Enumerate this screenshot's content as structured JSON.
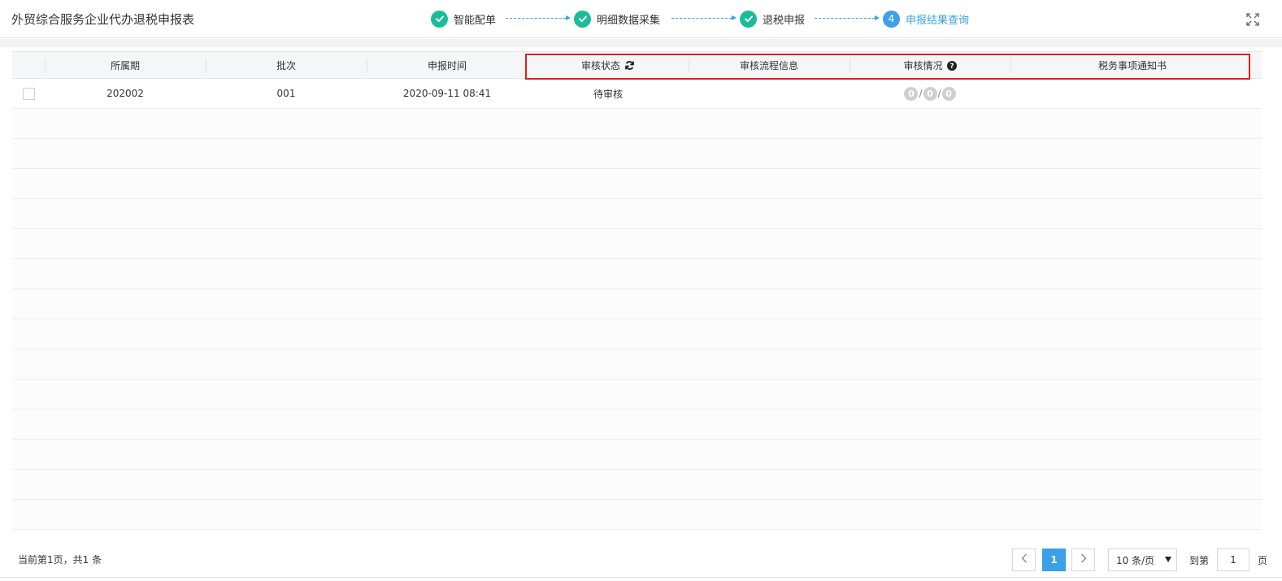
{
  "header": {
    "title": "外贸综合服务企业代办退税申报表",
    "steps": [
      {
        "label": "智能配单",
        "state": "done"
      },
      {
        "label": "明细数据采集",
        "state": "done"
      },
      {
        "label": "退税申报",
        "state": "done"
      },
      {
        "label": "申报结果查询",
        "state": "active",
        "number": "4"
      }
    ],
    "fullscreen_icon": "fullscreen-icon"
  },
  "table": {
    "columns": [
      "所属期",
      "批次",
      "申报时间",
      "审核状态",
      "审核流程信息",
      "审核情况",
      "税务事项通知书"
    ],
    "rows": [
      {
        "period": "202002",
        "batch": "001",
        "time": "2020-09-11 08:41",
        "status": "待审核",
        "flow": "",
        "review": [
          "0",
          "0",
          "0"
        ],
        "notice": ""
      }
    ],
    "empty_rows": 14
  },
  "footer": {
    "page_info": "当前第1页，共1 条",
    "current_page": "1",
    "page_size": "10 条/页",
    "goto_label": "到第",
    "goto_value": "1",
    "page_suffix": "页"
  },
  "colors": {
    "accent": "#3aa0e8",
    "done": "#1bbc9b",
    "highlight": "#e02020"
  }
}
